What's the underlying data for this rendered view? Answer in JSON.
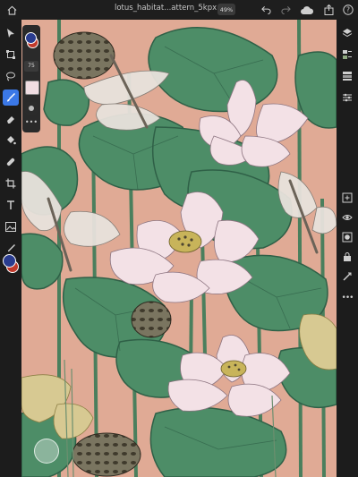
{
  "document": {
    "title": "lotus_habitat...attern_5kpx (2)",
    "zoom": "49%"
  },
  "toolbar_left": {
    "tools": [
      {
        "name": "select",
        "icon": "arrow-pointer-icon"
      },
      {
        "name": "transform",
        "icon": "transform-icon"
      },
      {
        "name": "lasso",
        "icon": "lasso-icon"
      },
      {
        "name": "brush",
        "icon": "brush-icon",
        "active": true
      },
      {
        "name": "eraser",
        "icon": "eraser-icon"
      },
      {
        "name": "fill",
        "icon": "paint-bucket-icon"
      },
      {
        "name": "healing",
        "icon": "bandage-icon"
      },
      {
        "name": "crop",
        "icon": "crop-icon"
      },
      {
        "name": "type",
        "icon": "type-icon"
      },
      {
        "name": "place-image",
        "icon": "image-icon"
      },
      {
        "name": "eyedropper",
        "icon": "eyedropper-icon"
      }
    ],
    "brush_size": "75",
    "fg_color": "#2a3c8f",
    "bg_color": "#c0392b"
  },
  "toolbar_right": {
    "items": [
      {
        "name": "layers",
        "icon": "layers-icon"
      },
      {
        "name": "layer-thumbs",
        "icon": "layer-thumbnails-icon"
      },
      {
        "name": "layer-stack",
        "icon": "layer-stack-icon"
      },
      {
        "name": "properties",
        "icon": "sliders-icon"
      },
      {
        "name": "add-layer",
        "icon": "add-layer-icon"
      },
      {
        "name": "visibility",
        "icon": "eye-icon"
      },
      {
        "name": "mask",
        "icon": "mask-icon"
      },
      {
        "name": "lock",
        "icon": "lock-icon"
      },
      {
        "name": "adjustments",
        "icon": "adjustments-icon"
      },
      {
        "name": "more",
        "icon": "more-icon"
      }
    ]
  },
  "colors": {
    "canvas": "#e0aa95",
    "leaf": "#4d8d67",
    "leaf_dark": "#2f6047",
    "petal": "#f3e1e6",
    "pod": "#7a7560"
  }
}
